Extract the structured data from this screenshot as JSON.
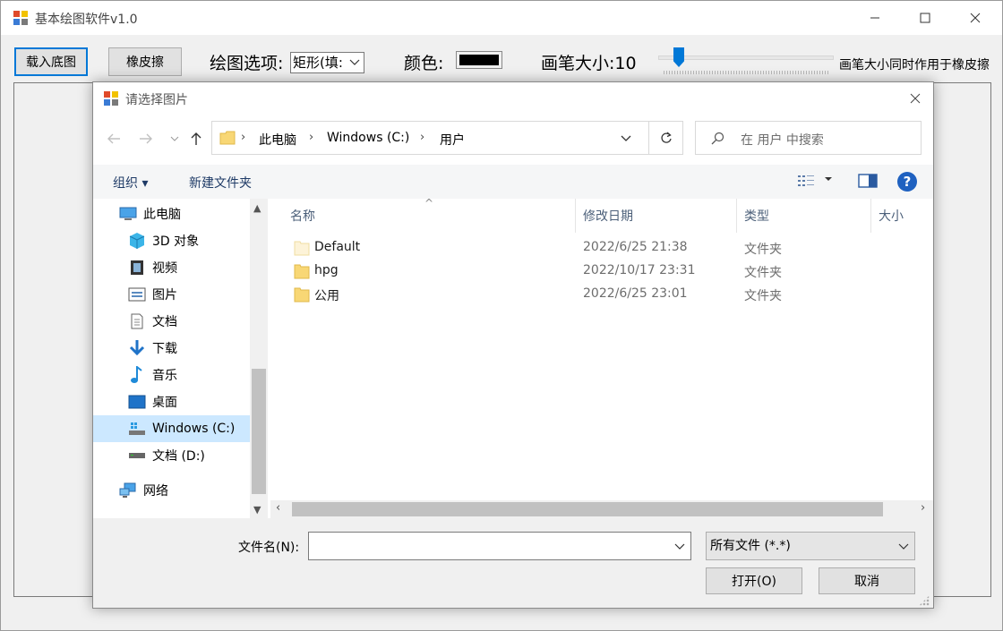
{
  "main": {
    "title": "基本绘图软件v1.0",
    "load_button": "载入底图",
    "eraser_button": "橡皮擦",
    "draw_option_label": "绘图选项:",
    "shape_value": "矩形(填:",
    "color_label": "颜色:",
    "color_value": "#000000",
    "pen_size_label": "画笔大小:10",
    "pen_size_value": 10,
    "pen_size_note": "画笔大小同时作用于橡皮擦"
  },
  "dialog": {
    "title": "请选择图片",
    "breadcrumb": [
      "此电脑",
      "Windows (C:)",
      "用户"
    ],
    "search_placeholder": "在 用户 中搜索",
    "organize": "组织 ▾",
    "new_folder": "新建文件夹",
    "nav": {
      "this_pc": "此电脑",
      "objects3d": "3D 对象",
      "videos": "视频",
      "pictures": "图片",
      "documents": "文档",
      "downloads": "下载",
      "music": "音乐",
      "desktop": "桌面",
      "drive_c": "Windows (C:)",
      "drive_d": "文档 (D:)",
      "network": "网络"
    },
    "columns": {
      "name": "名称",
      "modified": "修改日期",
      "type": "类型",
      "size": "大小"
    },
    "files": [
      {
        "name": "Default",
        "modified": "2022/6/25 21:38",
        "type": "文件夹"
      },
      {
        "name": "hpg",
        "modified": "2022/10/17 23:31",
        "type": "文件夹"
      },
      {
        "name": "公用",
        "modified": "2022/6/25 23:01",
        "type": "文件夹"
      }
    ],
    "filename_label": "文件名(N):",
    "filename_value": "",
    "filetype_value": "所有文件 (*.*)",
    "open_button": "打开(O)",
    "cancel_button": "取消"
  }
}
